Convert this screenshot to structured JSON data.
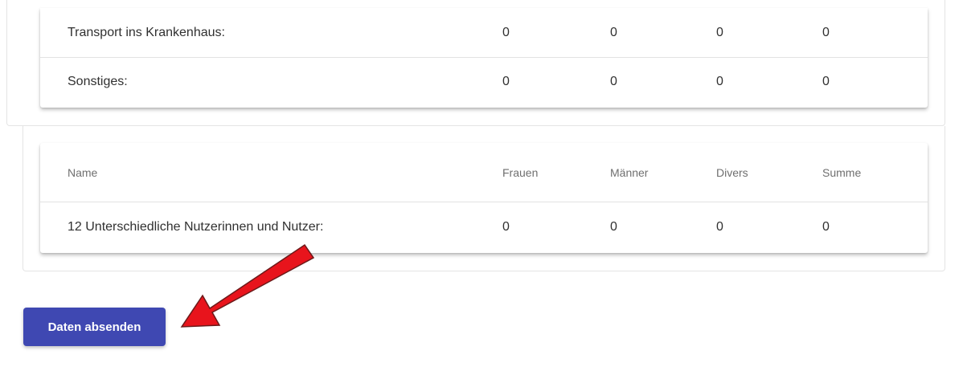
{
  "table_top": {
    "rows": [
      {
        "name": "Transport ins Krankenhaus:",
        "frauen": "0",
        "maenner": "0",
        "divers": "0",
        "summe": "0"
      },
      {
        "name": "Sonstiges:",
        "frauen": "0",
        "maenner": "0",
        "divers": "0",
        "summe": "0"
      }
    ]
  },
  "table_bottom": {
    "headers": {
      "name": "Name",
      "frauen": "Frauen",
      "maenner": "Männer",
      "divers": "Divers",
      "summe": "Summe"
    },
    "rows": [
      {
        "name": "12 Unterschiedliche Nutzerinnen und Nutzer:",
        "frauen": "0",
        "maenner": "0",
        "divers": "0",
        "summe": "0"
      }
    ]
  },
  "submit": {
    "label": "Daten absenden"
  },
  "colors": {
    "button": "#3f48b2",
    "arrow": "#e8141c"
  },
  "annotation": {
    "icon": "red-arrow-icon"
  }
}
